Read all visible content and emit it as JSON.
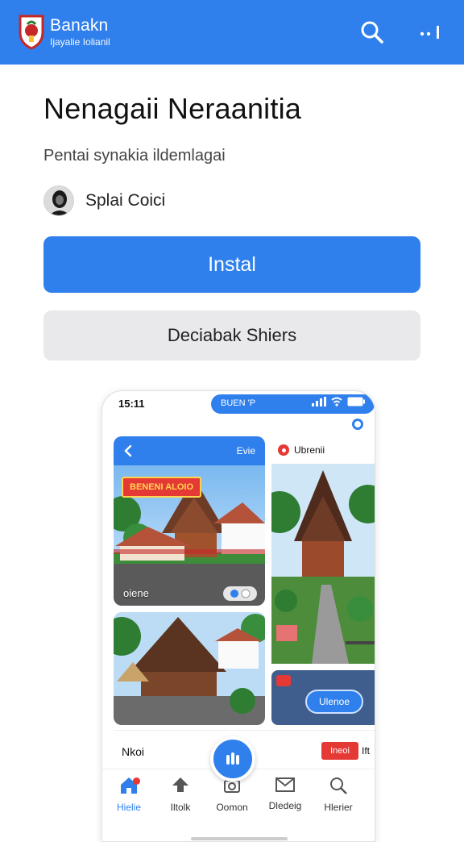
{
  "app_bar": {
    "brand_name": "Banakn",
    "brand_tagline": "Ijayalie Iolianil",
    "icons": [
      "logo-shield",
      "search-icon",
      "more-icon"
    ],
    "color": "#2f80ed"
  },
  "header": {
    "title": "Nenagaii Neraanitia",
    "subtitle": "Pentai synakia ildemlagai",
    "developer": "Splai Coici"
  },
  "actions": {
    "install_label": "Instal",
    "secondary_label": "Deciabak Shiers"
  },
  "screenshot": {
    "status_time": "15:11",
    "status_pill": "BUEN 'P",
    "card_left": {
      "back_icon": "chevron-left-icon",
      "head_right": "Evie",
      "tag": "BENENI ALOIO",
      "caption": "oiene"
    },
    "card_right": {
      "title": "Ubrenii"
    },
    "card_right2": {
      "button": "Ulenoe"
    },
    "bottom_row": {
      "label": "Nkoi",
      "red_button": "Ineoi",
      "red_text": "Ift"
    },
    "nav": [
      {
        "label": "Hielie",
        "icon": "home-icon",
        "active": true
      },
      {
        "label": "Iltolk",
        "icon": "share-icon",
        "active": false
      },
      {
        "label": "Oomon",
        "icon": "camera-icon",
        "active": false
      },
      {
        "label": "Dledeig",
        "icon": "mail-icon",
        "active": false
      },
      {
        "label": "Hlerier",
        "icon": "search-icon",
        "active": false
      }
    ]
  }
}
